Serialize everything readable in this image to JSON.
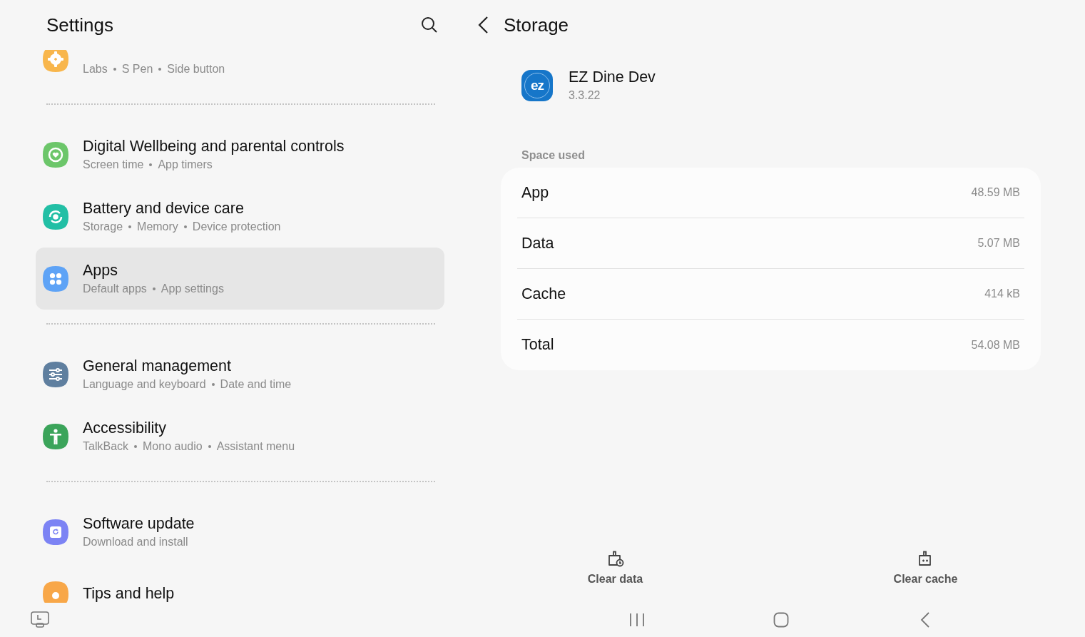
{
  "settings": {
    "title": "Settings",
    "groups": [
      [
        {
          "subtitle": [
            "Labs",
            "S Pen",
            "Side button"
          ],
          "color": "#f8b64c",
          "selected": false
        }
      ],
      [
        {
          "title": "Digital Wellbeing and parental controls",
          "subtitle": [
            "Screen time",
            "App timers"
          ],
          "color": "#6cc66a",
          "selected": false
        },
        {
          "title": "Battery and device care",
          "subtitle": [
            "Storage",
            "Memory",
            "Device protection"
          ],
          "color": "#22bfa5",
          "selected": false
        },
        {
          "title": "Apps",
          "subtitle": [
            "Default apps",
            "App settings"
          ],
          "color": "#5ea3f6",
          "selected": true
        }
      ],
      [
        {
          "title": "General management",
          "subtitle": [
            "Language and keyboard",
            "Date and time"
          ],
          "color": "#5f7f9f",
          "selected": false
        },
        {
          "title": "Accessibility",
          "subtitle": [
            "TalkBack",
            "Mono audio",
            "Assistant menu"
          ],
          "color": "#3ba45a",
          "selected": false
        }
      ],
      [
        {
          "title": "Software update",
          "subtitle": [
            "Download and install"
          ],
          "color": "#7c83f4",
          "selected": false
        },
        {
          "title": "Tips and help",
          "color": "#f8a748",
          "selected": false
        }
      ]
    ]
  },
  "storage": {
    "title": "Storage",
    "app": {
      "name": "EZ Dine Dev",
      "version": "3.3.22",
      "logo_text": "ez"
    },
    "section": "Space used",
    "rows": [
      {
        "label": "App",
        "value": "48.59 MB"
      },
      {
        "label": "Data",
        "value": "5.07 MB"
      },
      {
        "label": "Cache",
        "value": "414 kB"
      },
      {
        "label": "Total",
        "value": "54.08 MB"
      }
    ]
  },
  "actions": [
    {
      "label": "Clear data"
    },
    {
      "label": "Clear cache"
    }
  ]
}
